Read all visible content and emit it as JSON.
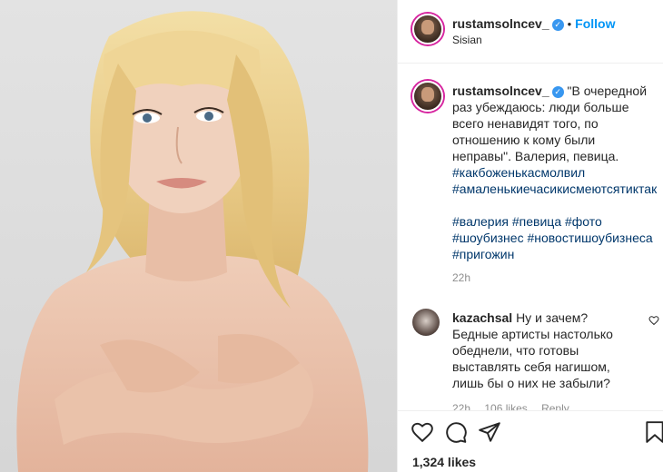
{
  "post": {
    "username": "rustamsolncev_",
    "follow_label": "Follow",
    "location": "Sisian",
    "caption": {
      "text": "\"В очередной раз убеждаюсь: люди больше всего ненавидят того, по отношению к кому были неправы\". Валерия, певица.",
      "hashtags_line1": [
        "#какбоженькасмолвил",
        "#амаленькиечасикисмеютсятиктак"
      ],
      "hashtags_line2": "#валерия #певица #фото #шоубизнес #новостишоубизнеса #пригожин",
      "time": "22h"
    },
    "comments": [
      {
        "username": "kazachsal",
        "text": "Ну и зачем? Бедные артисты настолько обеднели, что готовы выставлять себя нагишом, лишь бы о них не забыли?",
        "time": "22h",
        "likes": "106 likes",
        "reply_label": "Reply"
      }
    ],
    "likes_count": "1,324 likes"
  },
  "icons": {
    "verified": "verified-badge-icon",
    "like": "heart-icon",
    "comment": "comment-bubble-icon",
    "share": "paper-plane-icon",
    "save": "bookmark-icon"
  },
  "colors": {
    "follow": "#0095f6",
    "verified": "#3897f0",
    "hashtag": "#00376b",
    "muted": "#8e8e8e"
  }
}
